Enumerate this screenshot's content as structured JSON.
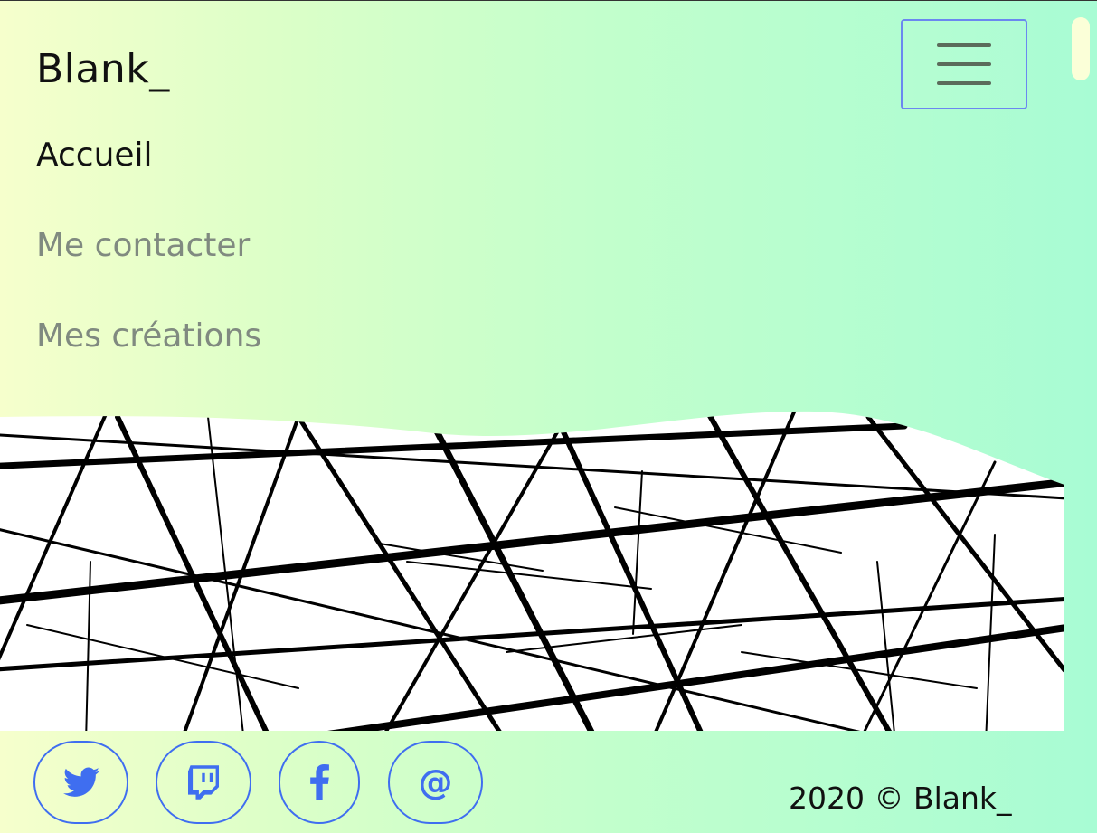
{
  "navbar": {
    "brand": "Blank_",
    "items": [
      {
        "label": "Accueil",
        "active": true
      },
      {
        "label": "Me contacter",
        "active": false
      },
      {
        "label": "Mes créations",
        "active": false
      }
    ]
  },
  "social": [
    {
      "icon": "twitter-icon"
    },
    {
      "icon": "twitch-icon"
    },
    {
      "icon": "facebook-icon"
    },
    {
      "icon": "at-sign-icon",
      "glyph": "@"
    }
  ],
  "footer": {
    "copyright": "2020 © Blank_"
  },
  "colors": {
    "accent": "#3f6ef0",
    "nav_inactive": "#808a80",
    "nav_active": "#111111"
  }
}
